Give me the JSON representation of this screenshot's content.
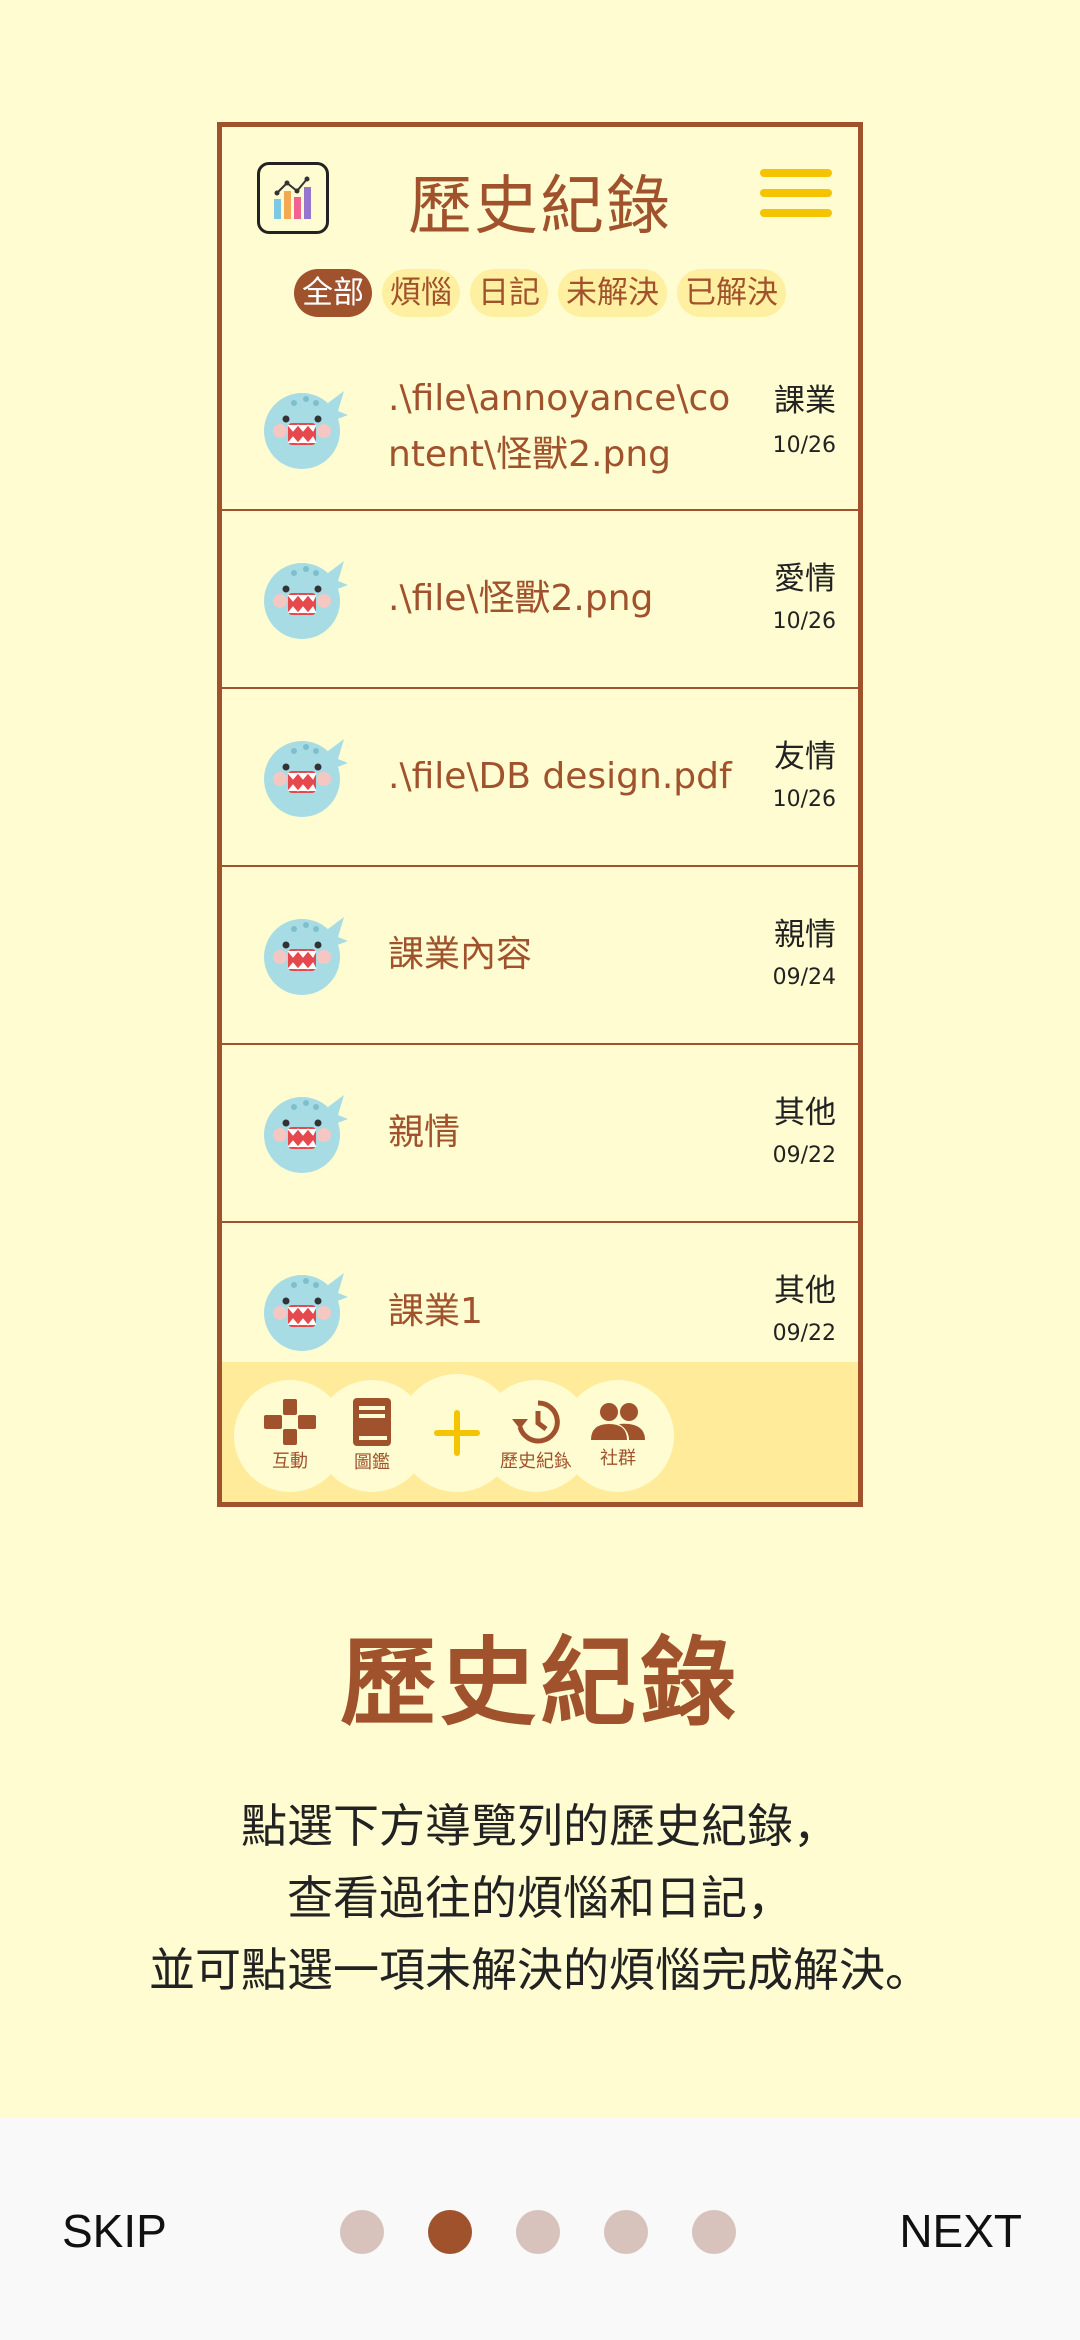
{
  "mockup": {
    "title": "歷史紀錄",
    "filters": [
      {
        "label": "全部",
        "active": true
      },
      {
        "label": "煩惱",
        "active": false
      },
      {
        "label": "日記",
        "active": false
      },
      {
        "label": "未解決",
        "active": false
      },
      {
        "label": "已解決",
        "active": false
      }
    ],
    "rows": [
      {
        "text": ".\\file\\annoyance\\content\\怪獸2.png",
        "category": "課業",
        "date": "10/26"
      },
      {
        "text": ".\\file\\怪獸2.png",
        "category": "愛情",
        "date": "10/26"
      },
      {
        "text": ".\\file\\DB design.pdf",
        "category": "友情",
        "date": "10/26"
      },
      {
        "text": "課業內容",
        "category": "親情",
        "date": "09/24"
      },
      {
        "text": "親情",
        "category": "其他",
        "date": "09/22"
      },
      {
        "text": "課業1",
        "category": "其他",
        "date": "09/22"
      }
    ],
    "nav": {
      "interact": "互動",
      "catalog": "圖鑑",
      "history": "歷史紀錄",
      "community": "社群"
    }
  },
  "heading": "歷史紀錄",
  "description": [
    "點選下方導覽列的歷史紀錄，",
    "查看過往的煩惱和日記，",
    "並可點選一項未解決的煩惱完成解決。"
  ],
  "footer": {
    "skip_label": "SKIP",
    "next_label": "NEXT",
    "page_count": 5,
    "current_page": 2
  },
  "colors": {
    "brand_brown": "#A0522D",
    "background": "#FFFCD1",
    "accent_yellow": "#F5C400",
    "chip_bg": "#FFEFA0"
  }
}
